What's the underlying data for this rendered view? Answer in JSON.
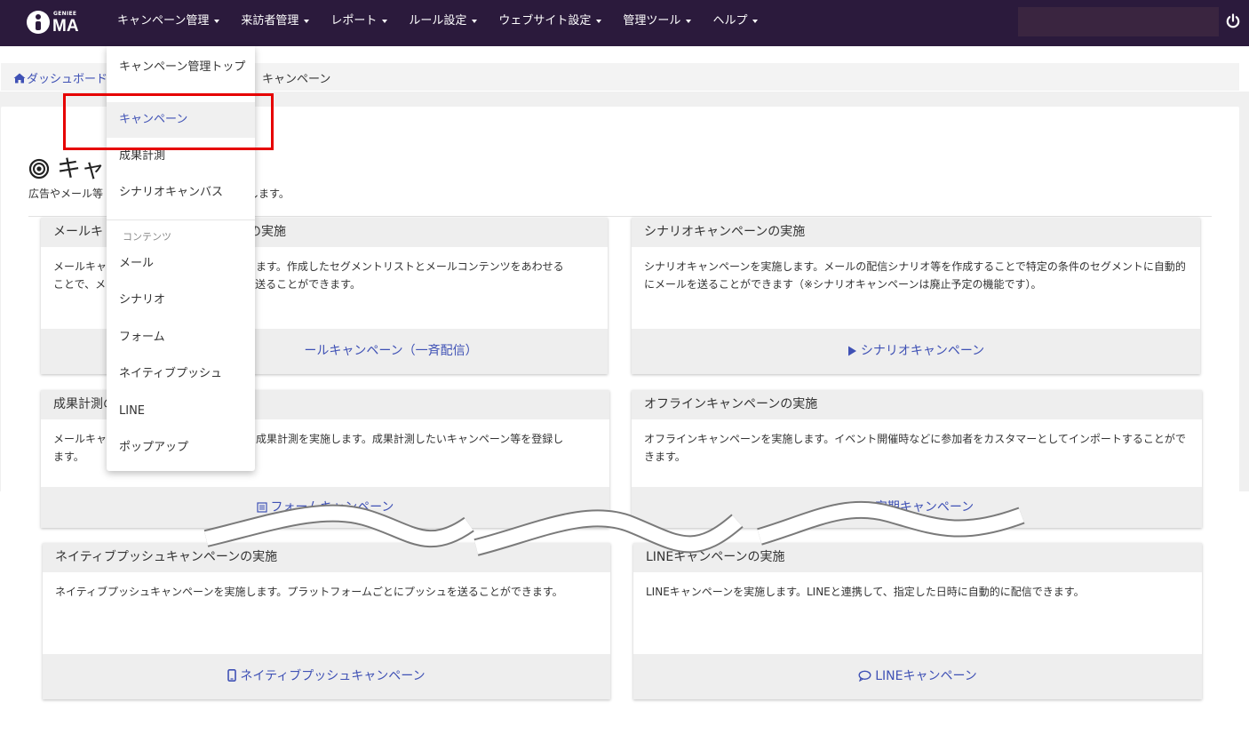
{
  "nav": {
    "logo_small": "GENIEE",
    "logo_main": "MA",
    "items": [
      {
        "label": "キャンペーン管理"
      },
      {
        "label": "来訪者管理"
      },
      {
        "label": "レポート"
      },
      {
        "label": "ルール設定"
      },
      {
        "label": "ウェブサイト設定"
      },
      {
        "label": "管理ツール"
      },
      {
        "label": "ヘルプ"
      }
    ]
  },
  "breadcrumb": {
    "home": "ダッシュボード",
    "current": "キャンペーン"
  },
  "page": {
    "title": "キャ",
    "desc_start": "広告やメール等",
    "desc_end": "します。"
  },
  "cards": {
    "mail": {
      "title_start": "メールキ",
      "title_end": "の実施",
      "body_line1_start": "メールキャ",
      "body_line1_end": "します。作成したセグメントリストとメールコンテンツをあわせる",
      "body_line2_start": "ことで、メ",
      "body_line2_end": "に送ることができます。",
      "link": "ールキャンペーン（一斉配信）"
    },
    "scenario": {
      "title": "シナリオキャンペーンの実施",
      "body": "シナリオキャンペーンを実施します。メールの配信シナリオ等を作成することで特定の条件のセグメントに自動的にメールを送ることができます（※シナリオキャンペーンは廃止予定の機能です）。",
      "link": "シナリオキャンペーン"
    },
    "conversion": {
      "title_start": "成果計測の",
      "body_line1_start": "メールキャ",
      "body_line1_end": "の成果計測を実施します。成果計測したいキャンペーン等を登録し",
      "body_line2": "ます。",
      "link": "フォームキャンペーン"
    },
    "offline": {
      "title": "オフラインキャンペーンの実施",
      "body": "オフラインキャンペーンを実施します。イベント開催時などに参加者をカスタマーとしてインポートすることができます。",
      "link": "定期キャンペーン"
    },
    "push": {
      "title": "ネイティブプッシュキャンペーンの実施",
      "body": "ネイティブプッシュキャンペーンを実施します。プラットフォームごとにプッシュを送ることができます。",
      "link": "ネイティブプッシュキャンペーン"
    },
    "line": {
      "title": "LINEキャンペーンの実施",
      "body": "LINEキャンペーンを実施します。LINEと連携して、指定した日時に自動的に配信できます。",
      "link": "LINEキャンペーン"
    }
  },
  "dropdown": {
    "top": "キャンペーン管理トップ",
    "campaign": "キャンペーン",
    "conversion": "成果計測",
    "scenario_canvas": "シナリオキャンバス",
    "contents_header": "コンテンツ",
    "mail": "メール",
    "scenario": "シナリオ",
    "form": "フォーム",
    "native_push": "ネイティブプッシュ",
    "line": "LINE",
    "popup": "ポップアップ"
  },
  "colors": {
    "nav_bg": "#2b1a3c",
    "link": "#3f51b5",
    "highlight": "#e60000"
  }
}
